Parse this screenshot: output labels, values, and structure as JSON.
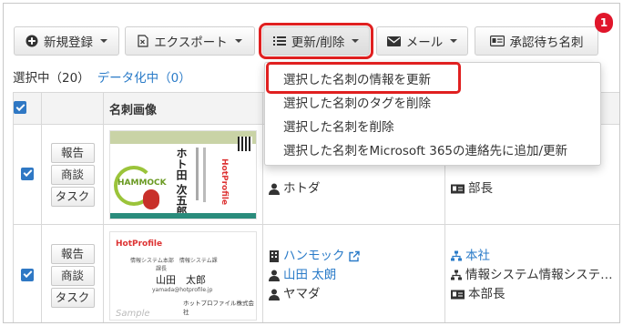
{
  "toolbar": {
    "new_label": "新規登録",
    "export_label": "エクスポート",
    "update_delete_label": "更新/削除",
    "mail_label": "メール",
    "pending_label": "承認待ち名刺",
    "pending_count": "1"
  },
  "selection": {
    "selected_text": "選択中（20）",
    "digitizing_text": "データ化中（0）"
  },
  "table": {
    "header_image": "名刺画像"
  },
  "row_actions": {
    "report": "報告",
    "deal": "商談",
    "task": "タスク"
  },
  "rows": [
    {
      "owner": "ホトダ",
      "title": "部長",
      "card": {
        "name": "ホト田 次五郎",
        "company": "HAMMOCK",
        "brand": "HotProfile"
      }
    },
    {
      "company": "ハンモック",
      "person": "山田 太朗",
      "owner": "ヤマダ",
      "dept1": "本社",
      "dept2": "情報システム情報システ…",
      "title": "本部長",
      "card": {
        "brand": "HotProfile",
        "dept": "情報システム本部　情報システム課",
        "role": "課長",
        "name": "山田　太郎",
        "email": "yamada@hotprofile.jp",
        "company": "ホットプロファイル株式会社",
        "watermark": "Sample"
      }
    }
  ],
  "menu": {
    "items": [
      "選択した名刺の情報を更新",
      "選択した名刺のタグを削除",
      "選択した名刺を削除",
      "選択した名刺をMicrosoft 365の連絡先に追加/更新"
    ]
  }
}
